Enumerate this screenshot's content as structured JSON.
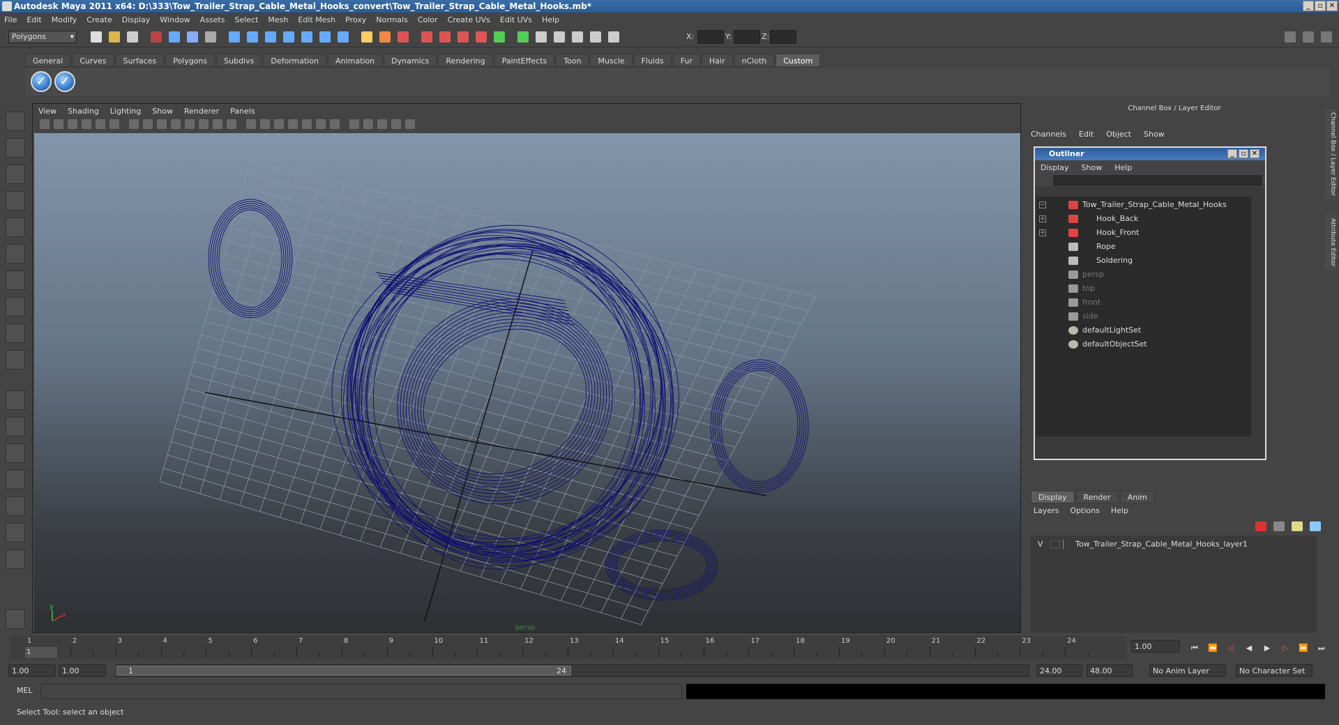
{
  "window": {
    "title": "Autodesk Maya 2011 x64: D:\\333\\Tow_Trailer_Strap_Cable_Metal_Hooks_convert\\Tow_Trailer_Strap_Cable_Metal_Hooks.mb*"
  },
  "menubar": [
    "File",
    "Edit",
    "Modify",
    "Create",
    "Display",
    "Window",
    "Assets",
    "Select",
    "Mesh",
    "Edit Mesh",
    "Proxy",
    "Normals",
    "Color",
    "Create UVs",
    "Edit UVs",
    "Help"
  ],
  "toolbar": {
    "mode": "Polygons",
    "x_label": "X:",
    "y_label": "Y:",
    "z_label": "Z:"
  },
  "shelf_tabs": [
    "General",
    "Curves",
    "Surfaces",
    "Polygons",
    "Subdivs",
    "Deformation",
    "Animation",
    "Dynamics",
    "Rendering",
    "PaintEffects",
    "Toon",
    "Muscle",
    "Fluids",
    "Fur",
    "Hair",
    "nCloth",
    "Custom"
  ],
  "shelf_active": "Custom",
  "viewport": {
    "menu": [
      "View",
      "Shading",
      "Lighting",
      "Show",
      "Renderer",
      "Panels"
    ],
    "camera_label": "persp",
    "axis_x": "x",
    "axis_y": "y",
    "wire_color": "#101070"
  },
  "channel_box": {
    "title": "Channel Box / Layer Editor",
    "menu": [
      "Channels",
      "Edit",
      "Object",
      "Show"
    ]
  },
  "outliner": {
    "title": "Outliner",
    "menu": [
      "Display",
      "Show",
      "Help"
    ],
    "items": [
      {
        "label": "Tow_Trailer_Strap_Cable_Metal_Hooks",
        "expand": "−",
        "icon": "mesh-group-icon",
        "dim": false,
        "indent": 0
      },
      {
        "label": "Hook_Back",
        "expand": "+",
        "icon": "mesh-group-icon",
        "dim": false,
        "indent": 1
      },
      {
        "label": "Hook_Front",
        "expand": "+",
        "icon": "mesh-group-icon",
        "dim": false,
        "indent": 1
      },
      {
        "label": "Rope",
        "expand": "",
        "icon": "mesh-icon",
        "dim": false,
        "indent": 1
      },
      {
        "label": "Soldering",
        "expand": "",
        "icon": "mesh-icon",
        "dim": false,
        "indent": 1
      },
      {
        "label": "persp",
        "expand": "",
        "icon": "camera-icon",
        "dim": true,
        "indent": 0
      },
      {
        "label": "top",
        "expand": "",
        "icon": "camera-icon",
        "dim": true,
        "indent": 0
      },
      {
        "label": "front",
        "expand": "",
        "icon": "camera-icon",
        "dim": true,
        "indent": 0
      },
      {
        "label": "side",
        "expand": "",
        "icon": "camera-icon",
        "dim": true,
        "indent": 0
      },
      {
        "label": "defaultLightSet",
        "expand": "",
        "icon": "set-icon",
        "dim": false,
        "indent": 0
      },
      {
        "label": "defaultObjectSet",
        "expand": "",
        "icon": "set-icon",
        "dim": false,
        "indent": 0
      }
    ]
  },
  "layer_editor": {
    "tabs": [
      "Display",
      "Render",
      "Anim"
    ],
    "active_tab": "Display",
    "menu": [
      "Layers",
      "Options",
      "Help"
    ],
    "layer": {
      "visible": "V",
      "name": "Tow_Trailer_Strap_Cable_Metal_Hooks_layer1"
    }
  },
  "side_tabs": [
    "Channel Box / Layer Editor",
    "Attribute Editor"
  ],
  "timeslider": {
    "frames": [
      "1",
      "2",
      "3",
      "4",
      "5",
      "6",
      "7",
      "8",
      "9",
      "10",
      "11",
      "12",
      "13",
      "14",
      "15",
      "16",
      "17",
      "18",
      "19",
      "20",
      "21",
      "22",
      "23",
      "24"
    ],
    "current_frame_marker": "1",
    "current_time": "1.00"
  },
  "range": {
    "start": "1.00",
    "playback_start": "1.00",
    "range_start": "1",
    "range_end": "24",
    "playback_end": "24.00",
    "end": "48.00",
    "anim_layer": "No Anim Layer",
    "character_set": "No Character Set"
  },
  "cmdline": {
    "label": "MEL"
  },
  "status": {
    "text": "Select Tool: select an object"
  }
}
